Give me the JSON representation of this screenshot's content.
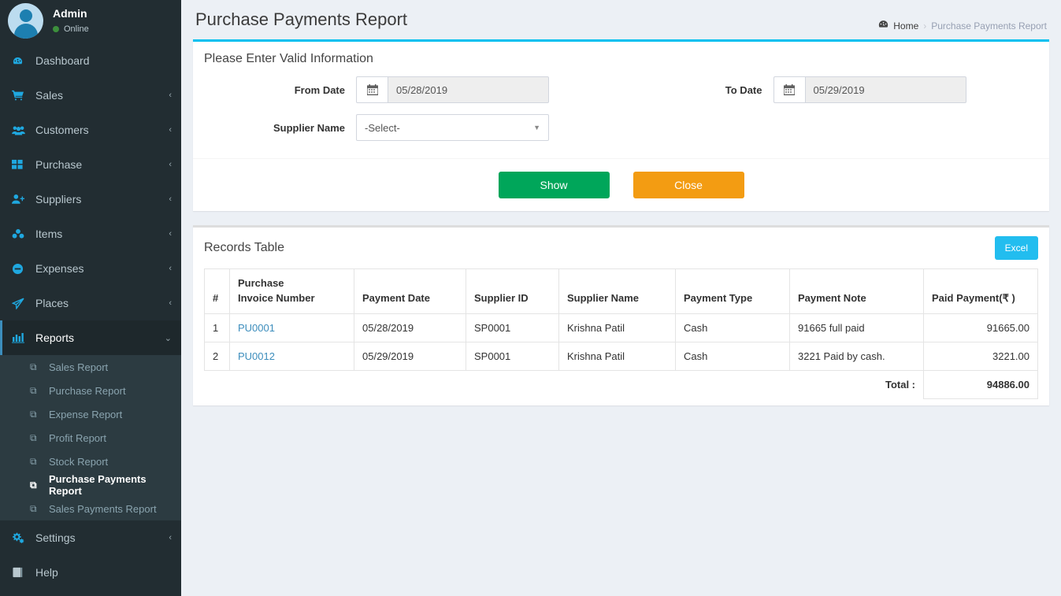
{
  "sidebar": {
    "user": {
      "name": "Admin",
      "status": "Online",
      "avatar_icon": "user-avatar-icon"
    },
    "items": [
      {
        "label": "Dashboard",
        "icon": "dashboard-icon",
        "glyph": "◕",
        "arrow": ""
      },
      {
        "label": "Sales",
        "icon": "cart-icon",
        "glyph": "🛒",
        "arrow": "‹"
      },
      {
        "label": "Customers",
        "icon": "users-icon",
        "glyph": "👥",
        "arrow": "‹"
      },
      {
        "label": "Purchase",
        "icon": "grid-icon",
        "glyph": "▦",
        "arrow": "‹"
      },
      {
        "label": "Suppliers",
        "icon": "user-plus-icon",
        "glyph": "👤",
        "arrow": "‹"
      },
      {
        "label": "Items",
        "icon": "cubes-icon",
        "glyph": "♣",
        "arrow": "‹"
      },
      {
        "label": "Expenses",
        "icon": "minus-circle-icon",
        "glyph": "⊖",
        "arrow": "‹"
      },
      {
        "label": "Places",
        "icon": "paper-plane-icon",
        "glyph": "➤",
        "arrow": "‹"
      },
      {
        "label": "Reports",
        "icon": "bar-chart-icon",
        "glyph": "█",
        "arrow": "⌄"
      },
      {
        "label": "Settings",
        "icon": "gears-icon",
        "glyph": "⚙",
        "arrow": "‹"
      },
      {
        "label": "Help",
        "icon": "book-icon",
        "glyph": "📕",
        "arrow": ""
      }
    ],
    "reports_submenu": [
      {
        "label": "Sales Report",
        "icon": "copy-icon"
      },
      {
        "label": "Purchase Report",
        "icon": "copy-icon"
      },
      {
        "label": "Expense Report",
        "icon": "copy-icon"
      },
      {
        "label": "Profit Report",
        "icon": "copy-icon"
      },
      {
        "label": "Stock Report",
        "icon": "copy-icon"
      },
      {
        "label": "Purchase Payments Report",
        "icon": "copy-icon"
      },
      {
        "label": "Sales Payments Report",
        "icon": "copy-icon"
      }
    ],
    "active_submenu_index": 5,
    "submenu_bullet": "⧉"
  },
  "header": {
    "title": "Purchase Payments Report",
    "breadcrumb": {
      "icon": "dashboard-icon",
      "home": "Home",
      "separator": "›",
      "current": "Purchase Payments Report"
    }
  },
  "filter_panel": {
    "title": "Please Enter Valid Information",
    "from_date": {
      "label": "From Date",
      "value": "05/28/2019",
      "icon": "calendar-icon",
      "glyph": "📅"
    },
    "to_date": {
      "label": "To Date",
      "value": "05/29/2019",
      "icon": "calendar-icon",
      "glyph": "📅"
    },
    "supplier": {
      "label": "Supplier Name",
      "value": "-Select-",
      "caret": "▼"
    },
    "buttons": {
      "show": "Show",
      "close": "Close"
    }
  },
  "records_panel": {
    "title": "Records Table",
    "excel_button": "Excel",
    "columns": [
      "#",
      "Purchase\nInvoice Number",
      "Payment Date",
      "Supplier ID",
      "Supplier Name",
      "Payment Type",
      "Payment Note",
      "Paid Payment(₹ )"
    ],
    "column_header_invoice_line1": "Purchase",
    "column_header_invoice_line2": "Invoice Number",
    "rows": [
      {
        "index": "1",
        "invoice": "PU0001",
        "payment_date": "05/28/2019",
        "supplier_id": "SP0001",
        "supplier_name": "Krishna Patil",
        "payment_type": "Cash",
        "payment_note": "91665 full paid",
        "paid_payment": "91665.00"
      },
      {
        "index": "2",
        "invoice": "PU0012",
        "payment_date": "05/29/2019",
        "supplier_id": "SP0001",
        "supplier_name": "Krishna Patil",
        "payment_type": "Cash",
        "payment_note": "3221 Paid by cash.",
        "paid_payment": "3221.00"
      }
    ],
    "total_label": "Total :",
    "total_value": "94886.00"
  },
  "colors": {
    "sidebar_bg": "#222d32",
    "accent_cyan": "#00c0ef",
    "link_blue": "#3c8dbc",
    "green": "#00a65a",
    "orange": "#f39c12",
    "excel_blue": "#22bdef",
    "page_bg": "#ecf0f5"
  }
}
